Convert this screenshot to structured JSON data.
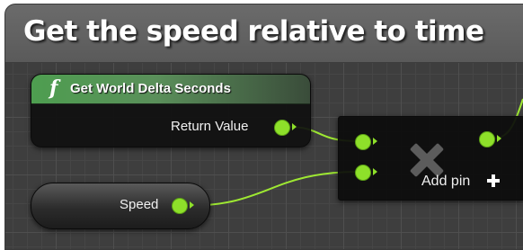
{
  "comment": {
    "title": "Get the speed relative to time",
    "header_color": "#5f5f5f"
  },
  "function_node": {
    "icon": "f",
    "title": "Get World Delta Seconds",
    "output_label": "Return Value",
    "header_color": "#4e9e50"
  },
  "add_node": {
    "icon_name": "x-icon",
    "add_pin_label": "Add pin",
    "add_pin_icon": "plus-icon"
  },
  "variable_node": {
    "label": "Speed"
  },
  "pin_color": "#8ee02a",
  "wire_color": "#9ee832"
}
